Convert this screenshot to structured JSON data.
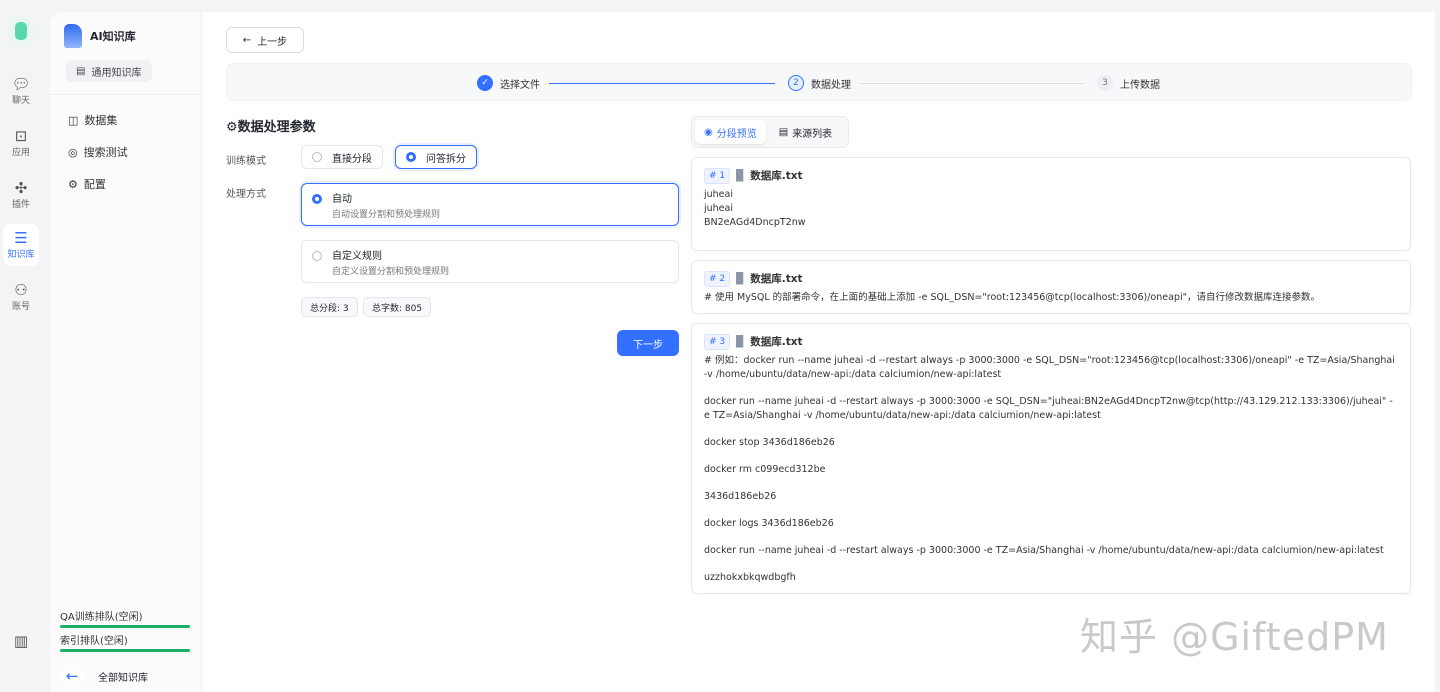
{
  "rail": {
    "items": [
      {
        "icon": "chat-icon",
        "label": "聊天"
      },
      {
        "icon": "robot-icon",
        "label": "应用"
      },
      {
        "icon": "puzzle-icon",
        "label": "插件"
      },
      {
        "icon": "database-icon",
        "label": "知识库"
      },
      {
        "icon": "user-icon",
        "label": "账号"
      }
    ]
  },
  "sidebar": {
    "title": "AI知识库",
    "library_type": "通用知识库",
    "nav": [
      {
        "icon": "chart-icon",
        "label": "数据集"
      },
      {
        "icon": "target-icon",
        "label": "搜索测试"
      },
      {
        "icon": "gear-icon",
        "label": "配置"
      }
    ],
    "queues": [
      "QA训练排队(空闲)",
      "索引排队(空闲)"
    ],
    "all_label": "全部知识库"
  },
  "main": {
    "back_label": "上一步",
    "steps": [
      {
        "num": "✓",
        "label": "选择文件"
      },
      {
        "num": "2",
        "label": "数据处理"
      },
      {
        "num": "3",
        "label": "上传数据"
      }
    ],
    "section_title": "数据处理参数",
    "train_mode_label": "训练模式",
    "train_modes": [
      "直接分段",
      "问答拆分"
    ],
    "process_label": "处理方式",
    "process_options": [
      {
        "title": "自动",
        "desc": "自动设置分割和预处理规则"
      },
      {
        "title": "自定义规则",
        "desc": "自定义设置分割和预处理规则"
      }
    ],
    "total_chunks": "总分段: 3",
    "total_chars": "总字数: 805",
    "next_label": "下一步",
    "tabs": [
      "分段预览",
      "来源列表"
    ],
    "chunks": [
      {
        "num": "# 1",
        "file": "数据库.txt",
        "lines": [
          "juheai",
          "juheai",
          "BN2eAGd4DncpT2nw"
        ]
      },
      {
        "num": "# 2",
        "file": "数据库.txt",
        "lines": [
          "# 使用 MySQL 的部署命令，在上面的基础上添加 -e SQL_DSN=\"root:123456@tcp(localhost:3306)/oneapi\"，请自行修改数据库连接参数。"
        ]
      },
      {
        "num": "# 3",
        "file": "数据库.txt",
        "lines": [
          "# 例如：docker run --name juheai -d --restart always -p 3000:3000 -e SQL_DSN=\"root:123456@tcp(localhost:3306)/oneapi\" -e TZ=Asia/Shanghai -v /home/ubuntu/data/new-api:/data calciumion/new-api:latest",
          "docker run --name juheai -d --restart always -p 3000:3000 -e SQL_DSN=\"juheai:BN2eAGd4DncpT2nw@tcp(http://43.129.212.133:3306)/juheai\" -e TZ=Asia/Shanghai -v /home/ubuntu/data/new-api:/data calciumion/new-api:latest",
          "docker stop 3436d186eb26",
          "docker rm c099ecd312be",
          "3436d186eb26",
          "docker logs 3436d186eb26",
          "docker run --name juheai -d --restart always -p 3000:3000 -e TZ=Asia/Shanghai -v /home/ubuntu/data/new-api:/data calciumion/new-api:latest",
          "uzzhokxbkqwdbgfh"
        ]
      }
    ]
  },
  "watermark": "知乎 @GiftedPM"
}
